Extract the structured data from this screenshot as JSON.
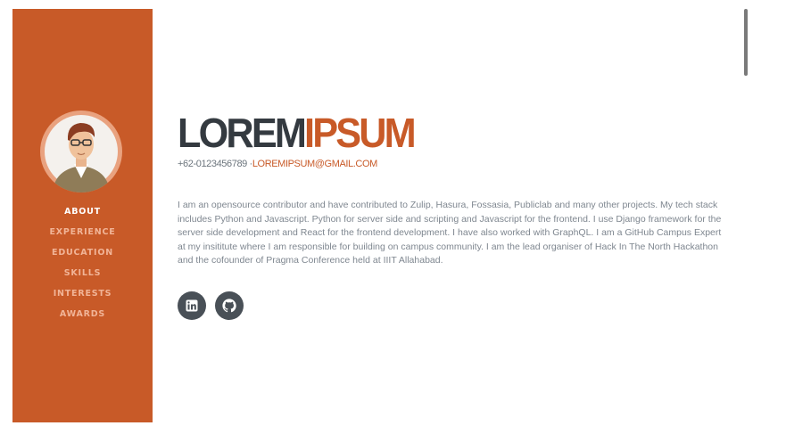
{
  "profile": {
    "first_name": "LOREM",
    "last_name": "IPSUM",
    "phone": "+62-0123456789 ·",
    "email": "LOREMIPSUM@GMAIL.COM",
    "bio": "I am an opensource contributor and have contributed to Zulip, Hasura, Fossasia, Publiclab and many other projects. My tech stack includes Python and Javascript. Python for server side and scripting and Javascript for the frontend. I use Django framework for the server side development and React for the frontend development. I have also worked with GraphQL. I am a GitHub Campus Expert at my insititute where I am responsible for building on campus community. I am the lead organiser of Hack In The North Hackathon and the cofounder of Pragma Conference held at IIIT Allahabad."
  },
  "nav": {
    "items": [
      {
        "label": "About",
        "active": true
      },
      {
        "label": "Experience"
      },
      {
        "label": "Education"
      },
      {
        "label": "Skills"
      },
      {
        "label": "Interests"
      },
      {
        "label": "Awards"
      }
    ]
  },
  "socials": {
    "icons": [
      "linkedin-icon",
      "github-icon"
    ]
  },
  "colors": {
    "accent": "#c85a28",
    "dark": "#343a40",
    "social_bg": "#495057"
  }
}
